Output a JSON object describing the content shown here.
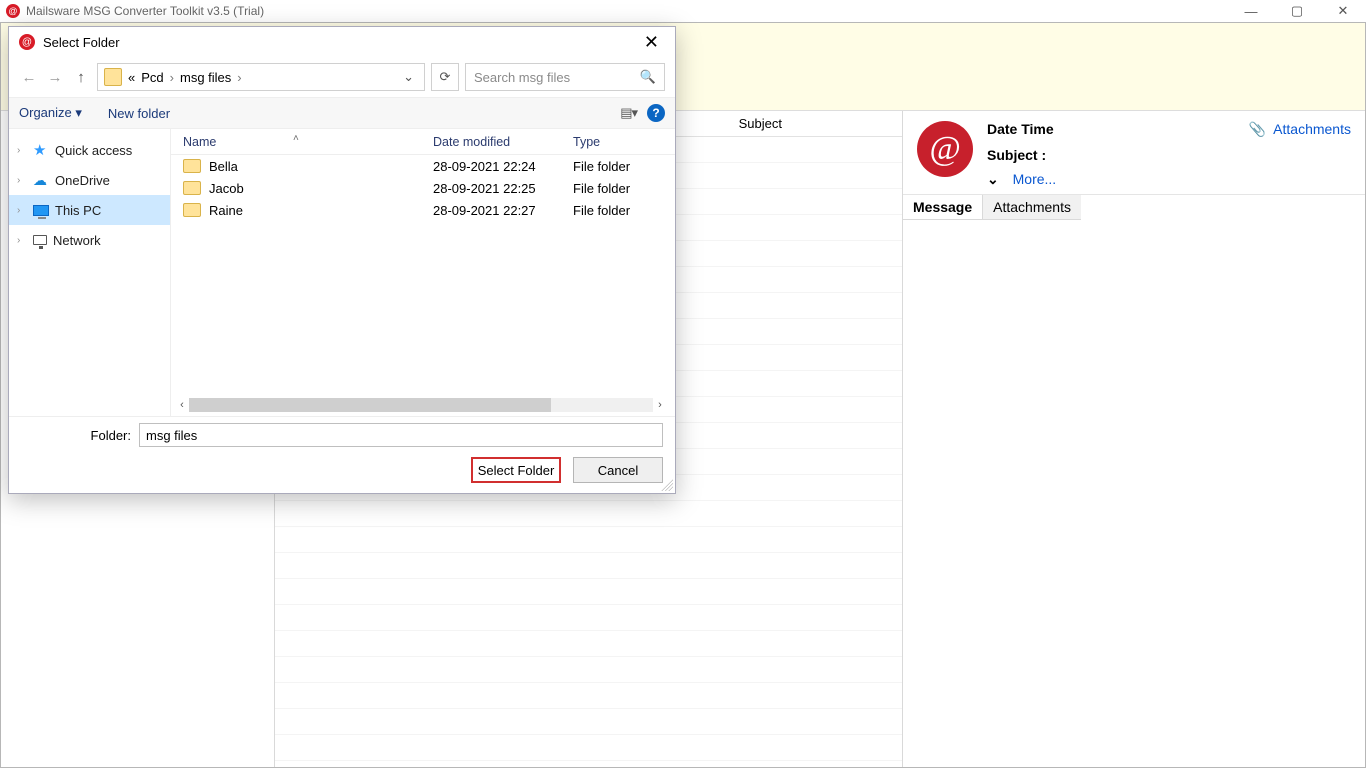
{
  "window": {
    "title": "Mailsware MSG Converter Toolkit v3.5 (Trial)"
  },
  "main": {
    "mid_header_subject": "Subject",
    "right_panel": {
      "date_time_label": "Date Time",
      "subject_label": "Subject :",
      "more_label": "More...",
      "attachments_link": "Attachments"
    },
    "tabs": {
      "message": "Message",
      "attachments": "Attachments"
    }
  },
  "dialog": {
    "title": "Select Folder",
    "breadcrumb": {
      "prefix": "«",
      "p1": "Pcd",
      "p2": "msg files"
    },
    "search_placeholder": "Search msg files",
    "toolbar": {
      "organize": "Organize",
      "new_folder": "New folder"
    },
    "tree": [
      {
        "label": "Quick access",
        "icon": "star"
      },
      {
        "label": "OneDrive",
        "icon": "cloud"
      },
      {
        "label": "This PC",
        "icon": "pc",
        "selected": true
      },
      {
        "label": "Network",
        "icon": "net"
      }
    ],
    "columns": {
      "name": "Name",
      "date": "Date modified",
      "type": "Type"
    },
    "rows": [
      {
        "name": "Bella",
        "date": "28-09-2021 22:24",
        "type": "File folder"
      },
      {
        "name": "Jacob",
        "date": "28-09-2021 22:25",
        "type": "File folder"
      },
      {
        "name": "Raine",
        "date": "28-09-2021 22:27",
        "type": "File folder"
      }
    ],
    "folder_label": "Folder:",
    "folder_value": "msg files",
    "select_btn": "Select Folder",
    "cancel_btn": "Cancel"
  }
}
